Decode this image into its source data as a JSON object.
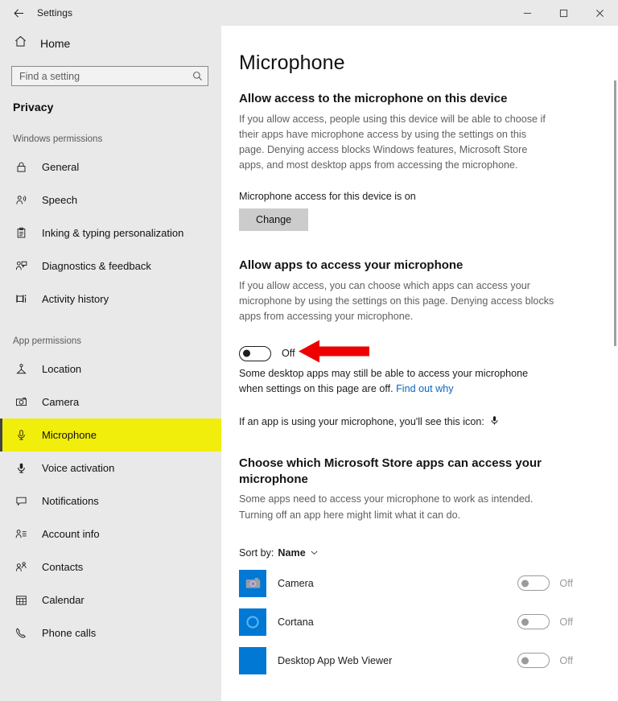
{
  "titlebar": {
    "back_label": "Back",
    "title": "Settings",
    "minimize_label": "Minimize",
    "maximize_label": "Maximize",
    "close_label": "Close"
  },
  "sidebar": {
    "home_label": "Home",
    "search": {
      "placeholder": "Find a setting",
      "value": ""
    },
    "category": "Privacy",
    "groups": [
      {
        "label": "Windows permissions",
        "items": [
          {
            "label": "General",
            "icon": "lock-icon",
            "selected": false
          },
          {
            "label": "Speech",
            "icon": "speech-icon",
            "selected": false
          },
          {
            "label": "Inking & typing personalization",
            "icon": "clipboard-icon",
            "selected": false
          },
          {
            "label": "Diagnostics & feedback",
            "icon": "diagnostics-icon",
            "selected": false
          },
          {
            "label": "Activity history",
            "icon": "activity-history-icon",
            "selected": false
          }
        ]
      },
      {
        "label": "App permissions",
        "items": [
          {
            "label": "Location",
            "icon": "location-icon",
            "selected": false
          },
          {
            "label": "Camera",
            "icon": "camera-icon",
            "selected": false
          },
          {
            "label": "Microphone",
            "icon": "microphone-icon",
            "selected": true
          },
          {
            "label": "Voice activation",
            "icon": "voice-activation-icon",
            "selected": false
          },
          {
            "label": "Notifications",
            "icon": "notification-icon",
            "selected": false
          },
          {
            "label": "Account info",
            "icon": "account-info-icon",
            "selected": false
          },
          {
            "label": "Contacts",
            "icon": "contacts-icon",
            "selected": false
          },
          {
            "label": "Calendar",
            "icon": "calendar-icon",
            "selected": false
          },
          {
            "label": "Phone calls",
            "icon": "phone-icon",
            "selected": false
          }
        ]
      }
    ],
    "highlight_color": "#f2ee0b"
  },
  "main": {
    "page_title": "Microphone",
    "section_device": {
      "heading": "Allow access to the microphone on this device",
      "description": "If you allow access, people using this device will be able to choose if their apps have microphone access by using the settings on this page. Denying access blocks Windows features, Microsoft Store apps, and most desktop apps from accessing the microphone.",
      "status": "Microphone access for this device is on",
      "change_button": "Change"
    },
    "section_apps": {
      "heading": "Allow apps to access your microphone",
      "description": "If you allow access, you can choose which apps can access your microphone by using the settings on this page. Denying access blocks apps from accessing your microphone.",
      "toggle_state": "Off",
      "note_text": "Some desktop apps may still be able to access your microphone when settings on this page are off. ",
      "note_link": "Find out why",
      "icon_note": "If an app is using your microphone, you'll see this icon:",
      "arrow_color": "#ee0000"
    },
    "section_store": {
      "heading": "Choose which Microsoft Store apps can access your microphone",
      "description": "Some apps need to access your microphone to work as intended. Turning off an app here might limit what it can do.",
      "sort_label": "Sort by:",
      "sort_value": "Name",
      "apps": [
        {
          "name": "Camera",
          "state": "Off",
          "icon": "camera-app-icon",
          "tile_color": "#1a7fd4"
        },
        {
          "name": "Cortana",
          "state": "Off",
          "icon": "cortana-app-icon",
          "tile_color": "#0d7cc8"
        },
        {
          "name": "Desktop App Web Viewer",
          "state": "Off",
          "icon": "desktop-app-web-viewer-icon",
          "tile_color": "#0a7bd0"
        }
      ]
    }
  }
}
